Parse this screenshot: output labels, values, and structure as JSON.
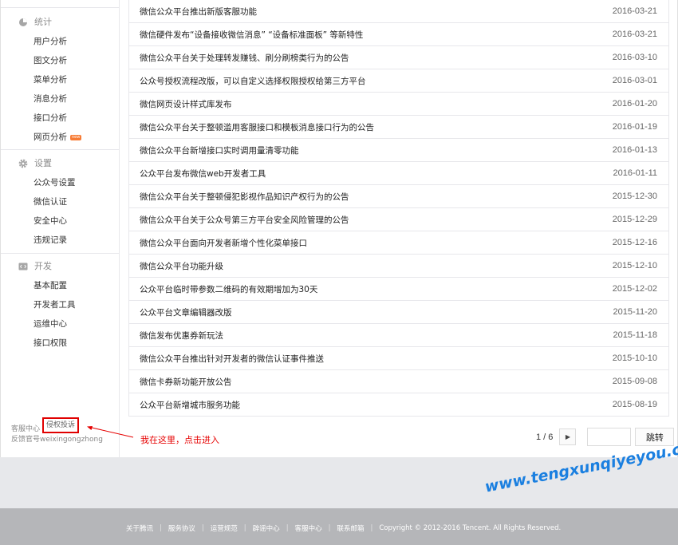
{
  "sidebar": {
    "groups": [
      {
        "title": "统计",
        "icon": "pie-chart-icon",
        "items": [
          "用户分析",
          "图文分析",
          "菜单分析",
          "消息分析",
          "接口分析",
          "网页分析"
        ]
      },
      {
        "title": "设置",
        "icon": "gear-icon",
        "items": [
          "公众号设置",
          "微信认证",
          "安全中心",
          "违规记录"
        ]
      },
      {
        "title": "开发",
        "icon": "code-icon",
        "items": [
          "基本配置",
          "开发者工具",
          "运维中心",
          "接口权限"
        ]
      }
    ],
    "new_badge": "new",
    "footer": {
      "service_center": "客服中心",
      "complaint": "侵权投诉",
      "feedback": "反馈官号weixingongzhong"
    }
  },
  "notices": [
    {
      "title": "微信公众平台推出新版客服功能",
      "date": "2016-03-21"
    },
    {
      "title": "微信硬件发布“设备接收微信消息” “设备标准面板” 等新特性",
      "date": "2016-03-21"
    },
    {
      "title": "微信公众平台关于处理转发赚钱、刷分刷榜类行为的公告",
      "date": "2016-03-10"
    },
    {
      "title": "公众号授权流程改版，可以自定义选择权限授权给第三方平台",
      "date": "2016-03-01"
    },
    {
      "title": "微信网页设计样式库发布",
      "date": "2016-01-20"
    },
    {
      "title": "微信公众平台关于整顿滥用客服接口和模板消息接口行为的公告",
      "date": "2016-01-19"
    },
    {
      "title": "微信公众平台新增接口实时调用量清零功能",
      "date": "2016-01-13"
    },
    {
      "title": "公众平台发布微信web开发者工具",
      "date": "2016-01-11"
    },
    {
      "title": "微信公众平台关于整顿侵犯影视作品知识产权行为的公告",
      "date": "2015-12-30"
    },
    {
      "title": "微信公众平台关于公众号第三方平台安全风险管理的公告",
      "date": "2015-12-29"
    },
    {
      "title": "微信公众平台面向开发者新增个性化菜单接口",
      "date": "2015-12-16"
    },
    {
      "title": "微信公众平台功能升级",
      "date": "2015-12-10"
    },
    {
      "title": "公众平台临时带参数二维码的有效期增加为30天",
      "date": "2015-12-02"
    },
    {
      "title": "公众平台文章编辑器改版",
      "date": "2015-11-20"
    },
    {
      "title": "微信发布优惠券新玩法",
      "date": "2015-11-18"
    },
    {
      "title": "微信公众平台推出针对开发者的微信认证事件推送",
      "date": "2015-10-10"
    },
    {
      "title": "微信卡券新功能开放公告",
      "date": "2015-09-08"
    },
    {
      "title": "公众平台新增城市服务功能",
      "date": "2015-08-19"
    }
  ],
  "annotation": "我在这里，点击进入",
  "pager": {
    "current": "1 / 6",
    "next_icon": "chevron-right-icon",
    "jump_label": "跳转",
    "input_value": ""
  },
  "watermark": "www.tengxunqiyeyou.com",
  "footer": {
    "links": [
      "关于腾讯",
      "服务协议",
      "运营规范",
      "辟谣中心",
      "客服中心",
      "联系邮箱"
    ],
    "copyright": "Copyright © 2012-2016 Tencent. All Rights Reserved."
  },
  "colors": {
    "accent_red": "#e60000",
    "watermark_blue": "#1a7fe0",
    "badge_orange": "#f77b34"
  }
}
